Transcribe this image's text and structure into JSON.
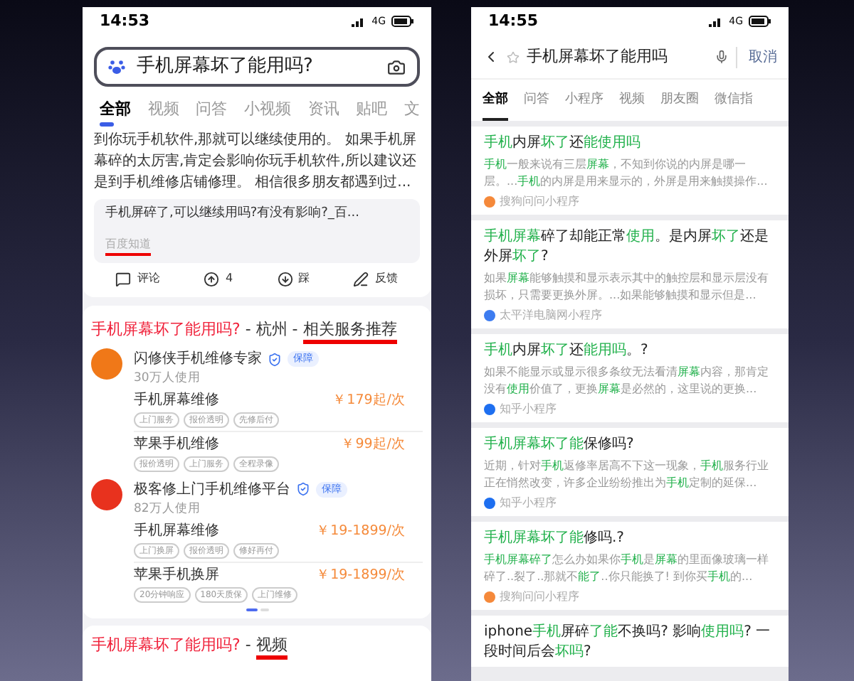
{
  "left_phone": {
    "status_bar": {
      "time": "14:53",
      "network": "4G"
    },
    "search": {
      "value": "手机屏幕坏了能用吗?"
    },
    "tabs": [
      {
        "label": "全部",
        "selected": true
      },
      {
        "label": "视频",
        "selected": false
      },
      {
        "label": "问答",
        "selected": false
      },
      {
        "label": "小视频",
        "selected": false
      },
      {
        "label": "资讯",
        "selected": false
      },
      {
        "label": "贴吧",
        "selected": false
      },
      {
        "label": "文",
        "selected": false
      }
    ],
    "answer": {
      "snippet": "到你玩手机软件,那就可以继续使用的。 如果手机屏幕碎的太厉害,肯定会影响你玩手机软件,所以建议还是到手机维修店铺修理。 相信很多朋友都遇到过...",
      "source_title": "手机屏碎了,可以继续用吗?有没有影响?_百...",
      "source": "百度知道",
      "actions": [
        {
          "kind": "comment",
          "label": "评论"
        },
        {
          "kind": "up",
          "label": "4"
        },
        {
          "kind": "down",
          "label": "踩"
        },
        {
          "kind": "feedback",
          "label": "反馈"
        }
      ]
    },
    "service_card": {
      "title": [
        {
          "kind": "query",
          "text": "手机屏幕坏了能用吗?"
        },
        {
          "kind": "plain",
          "text": " - 杭州 - "
        },
        {
          "kind": "marked",
          "text": "相关服务推荐"
        }
      ],
      "providers": [
        {
          "name": "闪修侠手机维修专家",
          "badge": "保障",
          "users": "30万人使用",
          "color": "#f07818",
          "services": [
            {
              "name": "手机屏幕维修",
              "price": "￥179起/次",
              "tags": [
                "上门服务",
                "报价透明",
                "先修后付"
              ]
            },
            {
              "name": "苹果手机维修",
              "price": "￥99起/次",
              "tags": [
                "报价透明",
                "上门服务",
                "全程录像"
              ]
            }
          ]
        },
        {
          "name": "极客修上门手机维修平台",
          "badge": "保障",
          "users": "82万人使用",
          "color": "#e8321e",
          "services": [
            {
              "name": "手机屏幕维修",
              "price": "￥19-1899/次",
              "tags": [
                "上门换屏",
                "报价透明",
                "修好再付"
              ]
            },
            {
              "name": "苹果手机换屏",
              "price": "￥19-1899/次",
              "tags": [
                "20分钟响应",
                "180天质保",
                "上门维修"
              ]
            }
          ]
        }
      ]
    },
    "video_card": {
      "title": [
        {
          "kind": "query",
          "text": "手机屏幕坏了能用吗?"
        },
        {
          "kind": "plain",
          "text": " - "
        },
        {
          "kind": "marked",
          "text": "视频"
        }
      ]
    }
  },
  "right_phone": {
    "status_bar": {
      "time": "14:55",
      "network": "4G"
    },
    "search": {
      "value": "手机屏幕坏了能用吗",
      "cancel": "取消"
    },
    "tabs": [
      {
        "label": "全部",
        "selected": true
      },
      {
        "label": "问答",
        "selected": false
      },
      {
        "label": "小程序",
        "selected": false
      },
      {
        "label": "视频",
        "selected": false
      },
      {
        "label": "朋友圈",
        "selected": false
      },
      {
        "label": "微信指",
        "selected": false
      }
    ],
    "results": [
      {
        "title": [
          {
            "text": "手机",
            "highlight": true
          },
          {
            "text": "内屏",
            "highlight": false
          },
          {
            "text": "坏了",
            "highlight": true
          },
          {
            "text": "还",
            "highlight": false
          },
          {
            "text": "能使用吗",
            "highlight": true
          }
        ],
        "snippet": [
          {
            "text": "手机",
            "highlight": true
          },
          {
            "text": "一般来说有三层",
            "highlight": false
          },
          {
            "text": "屏幕",
            "highlight": true
          },
          {
            "text": "，不知到你说的内屏是哪一层。...",
            "highlight": false
          },
          {
            "text": "手机",
            "highlight": true
          },
          {
            "text": "的内屏是用来显示的，外屏是用来触摸操作...",
            "highlight": false
          }
        ],
        "source": "搜狗问问小程序",
        "color": "#f5893a"
      },
      {
        "title": [
          {
            "text": "手机屏幕",
            "highlight": true
          },
          {
            "text": "碎了却能正常",
            "highlight": false
          },
          {
            "text": "使用",
            "highlight": true
          },
          {
            "text": "。是内屏",
            "highlight": false
          },
          {
            "text": "坏了",
            "highlight": true
          },
          {
            "text": "还是外屏",
            "highlight": false
          },
          {
            "text": "坏了",
            "highlight": true
          },
          {
            "text": "?",
            "highlight": false
          }
        ],
        "snippet": [
          {
            "text": "如果",
            "highlight": false
          },
          {
            "text": "屏幕",
            "highlight": true
          },
          {
            "text": "能够触摸和显示表示其中的触控层和显示层没有损坏，只需要更换外屏。...如果能够触摸和显示但是...",
            "highlight": false
          }
        ],
        "source": "太平洋电脑网小程序",
        "color": "#3d7cf0"
      },
      {
        "title": [
          {
            "text": "手机",
            "highlight": true
          },
          {
            "text": "内屏",
            "highlight": false
          },
          {
            "text": "坏了",
            "highlight": true
          },
          {
            "text": "还",
            "highlight": false
          },
          {
            "text": "能用吗",
            "highlight": true
          },
          {
            "text": "。?",
            "highlight": false
          }
        ],
        "snippet": [
          {
            "text": "如果不能显示或显示很多条纹无法看清",
            "highlight": false
          },
          {
            "text": "屏幕",
            "highlight": true
          },
          {
            "text": "内容，那肯定没有",
            "highlight": false
          },
          {
            "text": "使用",
            "highlight": true
          },
          {
            "text": "价值了，更换",
            "highlight": false
          },
          {
            "text": "屏幕",
            "highlight": true
          },
          {
            "text": "是必然的，这里说的更换...",
            "highlight": false
          }
        ],
        "source": "知乎小程序",
        "color": "#1e6ff0"
      },
      {
        "title": [
          {
            "text": "手机屏幕坏了能",
            "highlight": true
          },
          {
            "text": "保修吗?",
            "highlight": false
          }
        ],
        "snippet": [
          {
            "text": "近期，针对",
            "highlight": false
          },
          {
            "text": "手机",
            "highlight": true
          },
          {
            "text": "返修率居高不下这一现象，",
            "highlight": false
          },
          {
            "text": "手机",
            "highlight": true
          },
          {
            "text": "服务行业正在悄然改变，许多企业纷纷推出为",
            "highlight": false
          },
          {
            "text": "手机",
            "highlight": true
          },
          {
            "text": "定制的延保...",
            "highlight": false
          }
        ],
        "source": "知乎小程序",
        "color": "#1e6ff0"
      },
      {
        "title": [
          {
            "text": "手机屏幕坏了能",
            "highlight": true
          },
          {
            "text": "修吗.?",
            "highlight": false
          }
        ],
        "snippet": [
          {
            "text": "手机屏幕碎了",
            "highlight": true
          },
          {
            "text": "怎么办如果你",
            "highlight": false
          },
          {
            "text": "手机",
            "highlight": true
          },
          {
            "text": "是",
            "highlight": false
          },
          {
            "text": "屏幕",
            "highlight": true
          },
          {
            "text": "的里面像玻璃一样碎了..裂了..那就不",
            "highlight": false
          },
          {
            "text": "能了",
            "highlight": true
          },
          {
            "text": "..你只能换了! 到你买",
            "highlight": false
          },
          {
            "text": "手机",
            "highlight": true
          },
          {
            "text": "的...",
            "highlight": false
          }
        ],
        "source": "搜狗问问小程序",
        "color": "#f5893a"
      },
      {
        "title": [
          {
            "text": "iphone",
            "highlight": false
          },
          {
            "text": "手机",
            "highlight": true
          },
          {
            "text": "屏碎",
            "highlight": false
          },
          {
            "text": "了能",
            "highlight": true
          },
          {
            "text": "不换吗? 影响",
            "highlight": false
          },
          {
            "text": "使用吗",
            "highlight": true
          },
          {
            "text": "? 一段时间后会",
            "highlight": false
          },
          {
            "text": "坏吗",
            "highlight": true
          },
          {
            "text": "?",
            "highlight": false
          }
        ]
      }
    ]
  }
}
